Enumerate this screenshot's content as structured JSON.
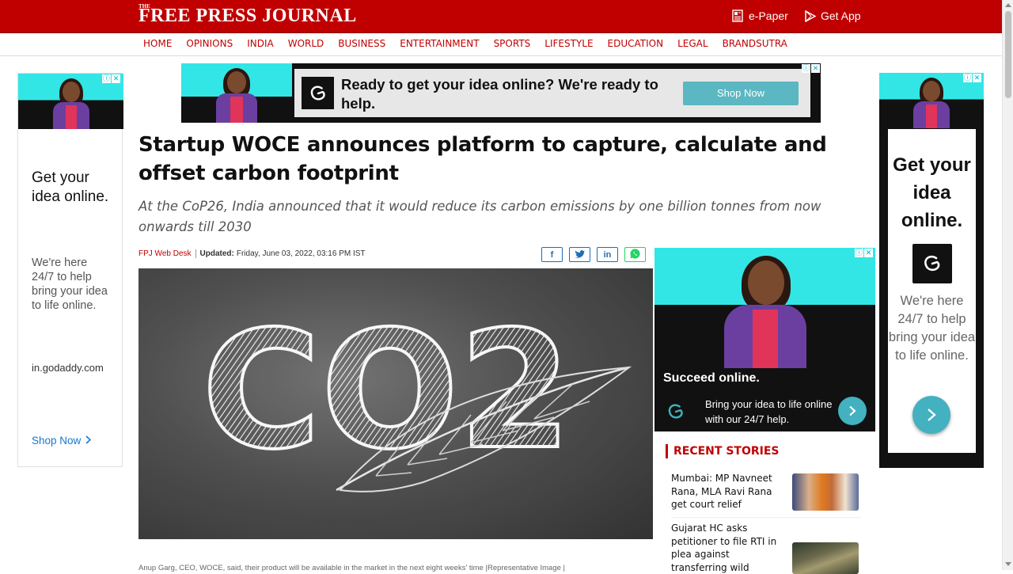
{
  "header": {
    "logo_small": "THE",
    "logo": "FREE PRESS JOURNAL",
    "epaper_label": "e-Paper",
    "getapp_label": "Get App"
  },
  "nav": {
    "items": [
      "HOME",
      "OPINIONS",
      "INDIA",
      "WORLD",
      "BUSINESS",
      "ENTERTAINMENT",
      "SPORTS",
      "LIFESTYLE",
      "EDUCATION",
      "LEGAL",
      "BRANDSUTRA"
    ]
  },
  "banner_ad": {
    "message": "Ready to get your idea online? We're ready to help.",
    "button": "Shop Now"
  },
  "left_ad": {
    "headline": "Get your idea online.",
    "body": "We're here 24/7 to help bring your idea to life online.",
    "domain": "in.godaddy.com",
    "cta": "Shop Now"
  },
  "right_ad": {
    "headline": "Get your idea online.",
    "body": "We're here 24/7 to help bring your idea to life online."
  },
  "article": {
    "headline": "Startup WOCE announces platform to capture, calculate and offset carbon footprint",
    "subheadline": "At the CoP26, India announced that it would reduce its carbon emissions by one billion tonnes from now onwards till 2030",
    "author": "FPJ Web Desk",
    "updated_label": "Updated:",
    "updated_value": "Friday, June 03, 2022, 03:16 PM IST",
    "image_text": "CO2",
    "caption": "Anup Garg, CEO, WOCE, said, their product will be available in the market in the next eight weeks' time |Representative Image |"
  },
  "share": {
    "facebook": "f",
    "twitter": "t",
    "linkedin": "in"
  },
  "side_ad": {
    "title": "Succeed online.",
    "body": "Bring your idea to life online with our 24/7 help."
  },
  "recent": {
    "title": "RECENT STORIES",
    "stories": [
      {
        "title": "Mumbai: MP Navneet Rana, MLA Ravi Rana get court relief"
      },
      {
        "title": "Gujarat HC asks petitioner to file RTI in plea against transferring wild"
      }
    ]
  },
  "colors": {
    "brand_red": "#c00000",
    "ad_cyan": "#33e6e6",
    "ad_teal_button": "#43b1bf"
  }
}
